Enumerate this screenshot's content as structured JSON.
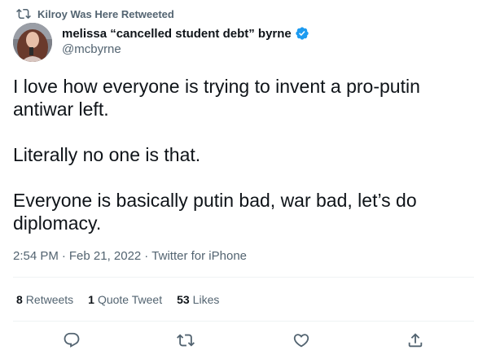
{
  "retweet_context": {
    "label": "Kilroy Was Here Retweeted",
    "icon": "retweet-icon"
  },
  "author": {
    "display_name": "melissa “cancelled student debt” byrne",
    "handle": "@mcbyrne",
    "verified": true
  },
  "tweet": {
    "text": "I love how everyone is trying to invent a pro-putin antiwar left.\n\nLiterally no one is that.\n\nEveryone is basically putin bad, war bad, let’s do diplomacy.",
    "time": "2:54 PM",
    "separator": "·",
    "date": "Feb 21, 2022",
    "source": "Twitter for iPhone"
  },
  "stats": {
    "retweets_count": "8",
    "retweets_label": "Retweets",
    "quotes_count": "1",
    "quotes_label": "Quote Tweet",
    "likes_count": "53",
    "likes_label": "Likes"
  },
  "actions": [
    {
      "name": "reply",
      "icon": "reply-icon"
    },
    {
      "name": "retweet",
      "icon": "retweet-icon"
    },
    {
      "name": "like",
      "icon": "heart-icon"
    },
    {
      "name": "share",
      "icon": "share-icon"
    }
  ],
  "colors": {
    "text": "#0f1419",
    "secondary": "#536471",
    "verified": "#1d9bf0",
    "divider": "#eff3f4"
  }
}
